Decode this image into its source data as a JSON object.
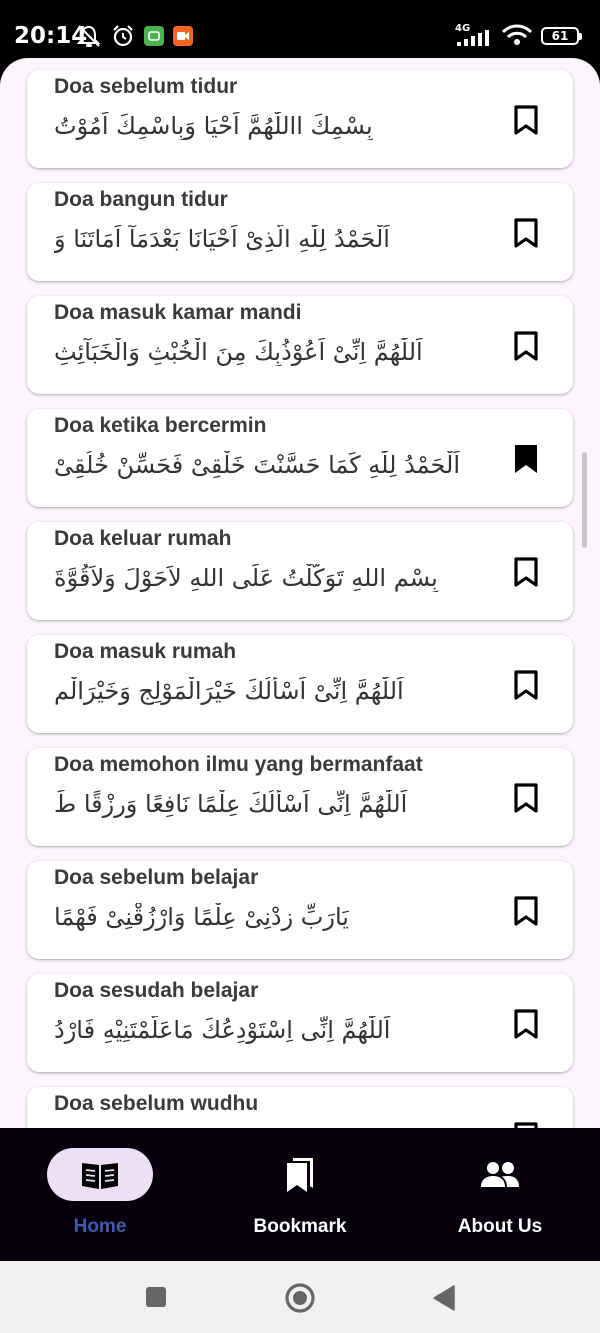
{
  "status_bar": {
    "time": "20:14",
    "network": "4G",
    "battery": "61"
  },
  "doa_list": [
    {
      "title": "Doa sebelum tidur",
      "arabic": "بِسْمِكَ االلّٰهُمَّ اَحْيَا وَبِاسْمِكَ اَمُوْتُ",
      "bookmarked": false
    },
    {
      "title": "Doa bangun tidur",
      "arabic": "اَلْحَمْدُ لِلّٰهِ الَّذِىْ اَحْيَانَا بَعْدَمَآ اَمَاتَنَا وَ",
      "bookmarked": false
    },
    {
      "title": "Doa masuk kamar mandi",
      "arabic": "اَللّٰهُمَّ اِنِّىْ اَعُوْذُبِكَ مِنَ الْخُبْثِ وَالْخَبَآئِثِ",
      "bookmarked": false
    },
    {
      "title": "Doa ketika bercermin",
      "arabic": "اَلْحَمْدُ لِلّٰهِ كَمَا حَسَّنْتَ خَلْقِىْ فَحَسِّنْ خُلُقِىْ",
      "bookmarked": true
    },
    {
      "title": "Doa keluar rumah",
      "arabic": "بِسْمِ اللهِ تَوَكَّلْتُ عَلَى اللهِ لاَحَوْلَ وَلاَقُوَّةَ",
      "bookmarked": false
    },
    {
      "title": "Doa masuk rumah",
      "arabic": "اَللّٰهُمَّ اِنِّىْ اَسْأَلُكَ خَيْرَالْمَوْلِجِ وَخَيْرَالْم",
      "bookmarked": false
    },
    {
      "title": "Doa memohon ilmu yang bermanfaat",
      "arabic": "اَللّٰهُمَّ اِنِّى اَسْأَلُكَ عِلْمًا نَافِعًا وَرِزْقًا طَ",
      "bookmarked": false
    },
    {
      "title": "Doa sebelum belajar",
      "arabic": "يَارَبِّ زِدْنِىْ عِلْمًا وَارْزُقْنِىْ فَهْمًا",
      "bookmarked": false
    },
    {
      "title": "Doa sesudah belajar",
      "arabic": "اَللّٰهُمَّ اِنِّى اِسْتَوْدِعُكَ مَاعَلَّمْتَنِيْهِ فَارْدُ",
      "bookmarked": false
    },
    {
      "title": "Doa sebelum wudhu",
      "arabic": "",
      "bookmarked": false
    }
  ],
  "bottom_nav": [
    {
      "label": "Home",
      "icon": "book-open-icon",
      "active": true
    },
    {
      "label": "Bookmark",
      "icon": "bookmarks-icon",
      "active": false
    },
    {
      "label": "About Us",
      "icon": "people-icon",
      "active": false
    }
  ],
  "colors": {
    "accent": "#3f5bab",
    "active_pill": "#ebe0f5",
    "nav_background": "#05000b",
    "content_background": "#fcf6fc"
  }
}
